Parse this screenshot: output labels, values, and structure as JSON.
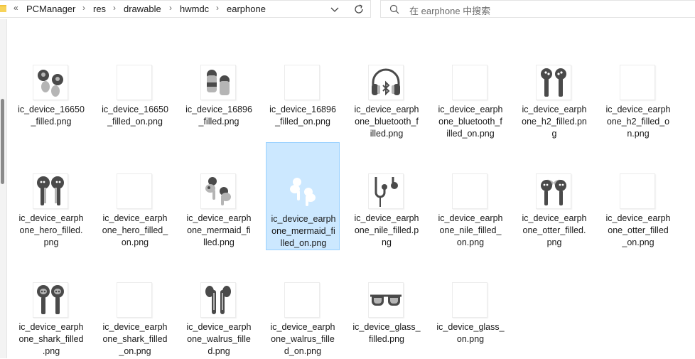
{
  "address_bar": {
    "overflow": "«",
    "breadcrumbs": [
      "PCManager",
      "res",
      "drawable",
      "hwmdc",
      "earphone"
    ],
    "separator": "›"
  },
  "search": {
    "placeholder": "在 earphone 中搜索"
  },
  "files": [
    {
      "line1": "ic_device_16650",
      "line2": "_filled.png",
      "line3": "",
      "icon": "buds-16650-icon",
      "selected": false
    },
    {
      "line1": "ic_device_16650",
      "line2": "_filled_on.png",
      "line3": "",
      "icon": "blank-icon",
      "selected": false
    },
    {
      "line1": "ic_device_16896",
      "line2": "_filled.png",
      "line3": "",
      "icon": "buds-16896-icon",
      "selected": false
    },
    {
      "line1": "ic_device_16896",
      "line2": "_filled_on.png",
      "line3": "",
      "icon": "blank-icon",
      "selected": false
    },
    {
      "line1": "ic_device_earph",
      "line2": "one_bluetooth_f",
      "line3": "illed.png",
      "icon": "headphones-bluetooth-icon",
      "selected": false
    },
    {
      "line1": "ic_device_earph",
      "line2": "one_bluetooth_f",
      "line3": "illed_on.png",
      "icon": "blank-icon",
      "selected": false
    },
    {
      "line1": "ic_device_earph",
      "line2": "one_h2_filled.pn",
      "line3": "g",
      "icon": "earbuds-h2-icon",
      "selected": false
    },
    {
      "line1": "ic_device_earph",
      "line2": "one_h2_filled_o",
      "line3": "n.png",
      "icon": "blank-icon",
      "selected": false
    },
    {
      "line1": "ic_device_earph",
      "line2": "one_hero_filled.",
      "line3": "png",
      "icon": "earbuds-hero-icon",
      "selected": false
    },
    {
      "line1": "ic_device_earph",
      "line2": "one_hero_filled_",
      "line3": "on.png",
      "icon": "blank-icon",
      "selected": false
    },
    {
      "line1": "ic_device_earph",
      "line2": "one_mermaid_fi",
      "line3": "lled.png",
      "icon": "earbuds-mermaid-icon",
      "selected": false
    },
    {
      "line1": "ic_device_earph",
      "line2": "one_mermaid_fi",
      "line3": "lled_on.png",
      "icon": "earbuds-mermaid-white-icon",
      "selected": true
    },
    {
      "line1": "ic_device_earph",
      "line2": "one_nile_filled.p",
      "line3": "ng",
      "icon": "earphone-nile-icon",
      "selected": false
    },
    {
      "line1": "ic_device_earph",
      "line2": "one_nile_filled_",
      "line3": "on.png",
      "icon": "blank-icon",
      "selected": false
    },
    {
      "line1": "ic_device_earph",
      "line2": "one_otter_filled.",
      "line3": "png",
      "icon": "earbuds-otter-icon",
      "selected": false
    },
    {
      "line1": "ic_device_earph",
      "line2": "one_otter_filled",
      "line3": "_on.png",
      "icon": "blank-icon",
      "selected": false
    },
    {
      "line1": "ic_device_earph",
      "line2": "one_shark_filled",
      "line3": ".png",
      "icon": "earbuds-shark-icon",
      "selected": false
    },
    {
      "line1": "ic_device_earph",
      "line2": "one_shark_filled",
      "line3": "_on.png",
      "icon": "blank-icon",
      "selected": false
    },
    {
      "line1": "ic_device_earph",
      "line2": "one_walrus_fille",
      "line3": "d.png",
      "icon": "earbuds-walrus-icon",
      "selected": false
    },
    {
      "line1": "ic_device_earph",
      "line2": "one_walrus_fille",
      "line3": "d_on.png",
      "icon": "blank-icon",
      "selected": false
    },
    {
      "line1": "ic_device_glass_",
      "line2": "filled.png",
      "line3": "",
      "icon": "glasses-icon",
      "selected": false
    },
    {
      "line1": "ic_device_glass_",
      "line2": "on.png",
      "line3": "",
      "icon": "blank-icon",
      "selected": false
    }
  ],
  "colors": {
    "selection_bg": "#cce8ff",
    "selection_border": "#99d1ff",
    "icon_dark": "#4a4a4a",
    "icon_light": "#b5b5b5"
  }
}
